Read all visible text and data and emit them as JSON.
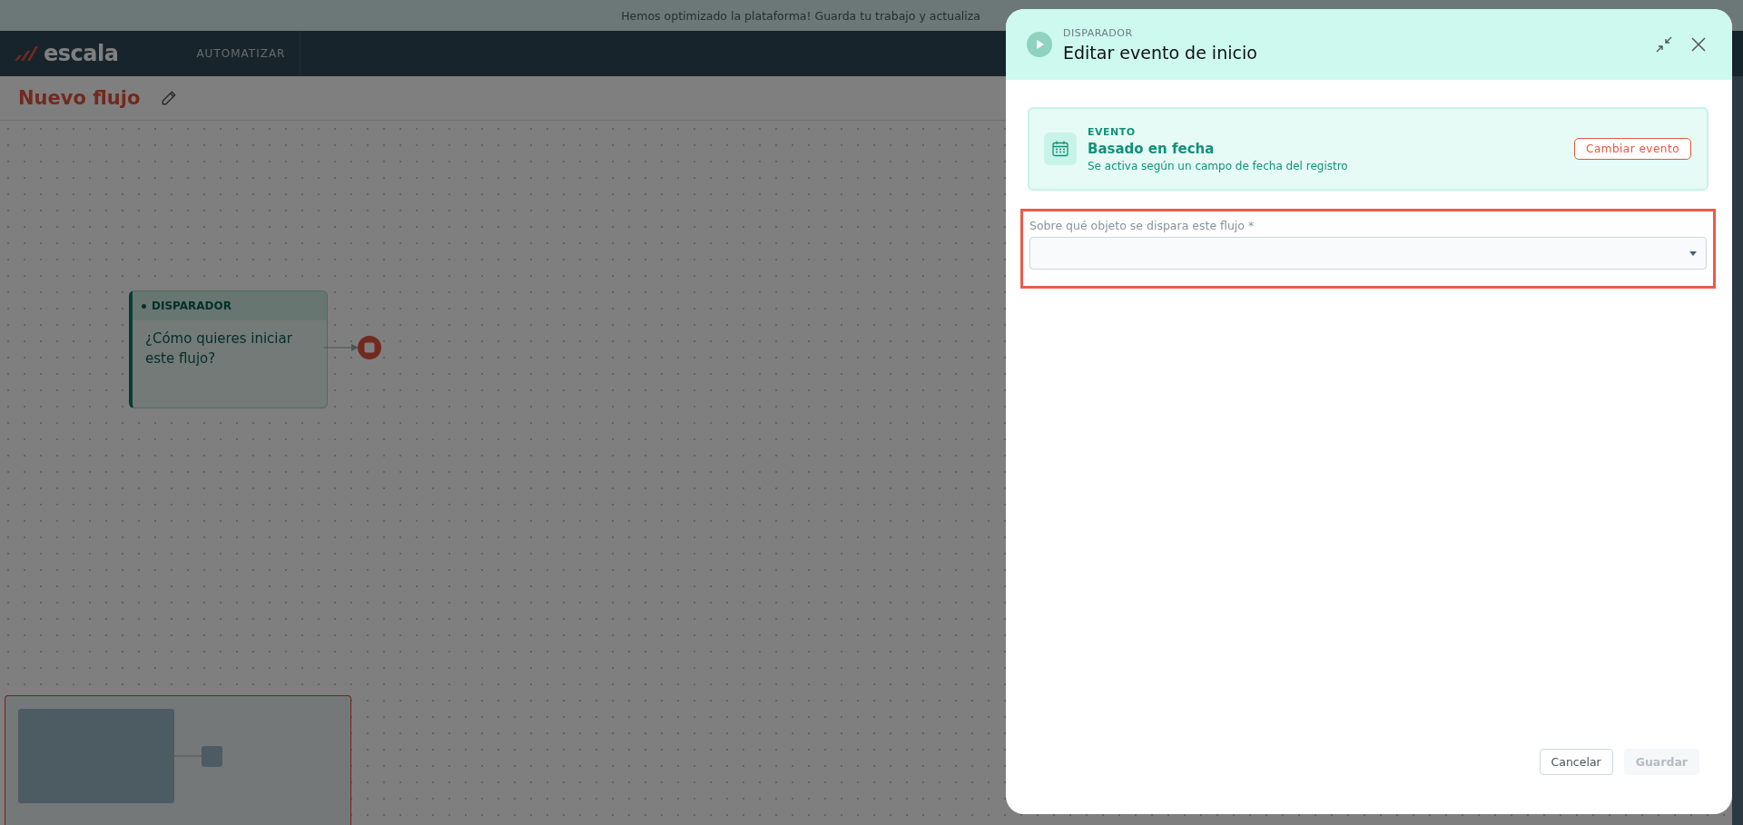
{
  "banner": {
    "text": "Hemos optimizado la plataforma! Guarda tu trabajo y actualiza"
  },
  "nav": {
    "logo_text": "escala",
    "items": [
      {
        "label": "AUTOMATIZAR",
        "selected": false
      }
    ]
  },
  "flow": {
    "title": "Nuevo flujo"
  },
  "node": {
    "badge": "DISPARADOR",
    "text": "¿Cómo quieres iniciar este flujo?"
  },
  "drawer": {
    "eyebrow": "DISPARADOR",
    "title": "Editar evento de inicio",
    "event": {
      "label": "EVENTO",
      "name": "Basado en fecha",
      "description": "Se activa según un campo de fecha del registro",
      "button": "Cambiar evento"
    },
    "field": {
      "label": "Sobre qué objeto se dispara este flujo *",
      "highlighted": true
    },
    "buttons": [
      {
        "label": "Cancelar",
        "disabled": false
      },
      {
        "label": "Guardar",
        "disabled": true
      }
    ]
  }
}
